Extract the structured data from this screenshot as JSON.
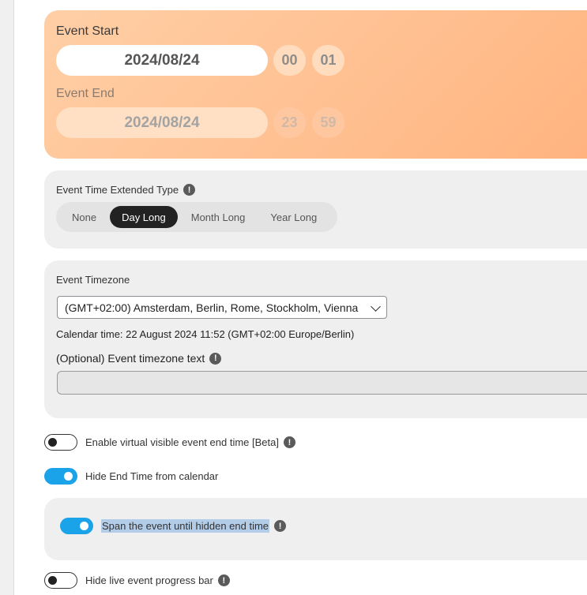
{
  "event_start": {
    "label": "Event Start",
    "date": "2024/08/24",
    "hour": "00",
    "minute": "01"
  },
  "event_end": {
    "label": "Event End",
    "date": "2024/08/24",
    "hour": "23",
    "minute": "59"
  },
  "extended_type": {
    "label": "Event Time Extended Type",
    "options": [
      "None",
      "Day Long",
      "Month Long",
      "Year Long"
    ],
    "selected": "Day Long"
  },
  "timezone": {
    "label": "Event Timezone",
    "selected": "(GMT+02:00) Amsterdam, Berlin, Rome, Stockholm, Vienna",
    "calendar_time": "Calendar time: 22 August 2024 11:52 (GMT+02:00 Europe/Berlin)",
    "optional_text_label": "(Optional) Event timezone text",
    "optional_text_value": ""
  },
  "toggles": {
    "virtual_end": {
      "label": "Enable virtual visible event end time [Beta]",
      "on": false
    },
    "hide_end": {
      "label": "Hide End Time from calendar",
      "on": true
    },
    "span_hidden": {
      "label": "Span the event until hidden end time",
      "on": true
    },
    "hide_progress": {
      "label": "Hide live event progress bar",
      "on": false
    }
  },
  "colors": {
    "accent": "#1aa3e8",
    "card_gradient_start": "#ffcfa6",
    "card_gradient_end": "#ffb37f",
    "selection_highlight": "#b3cde8"
  },
  "icons": {
    "info": "!"
  }
}
